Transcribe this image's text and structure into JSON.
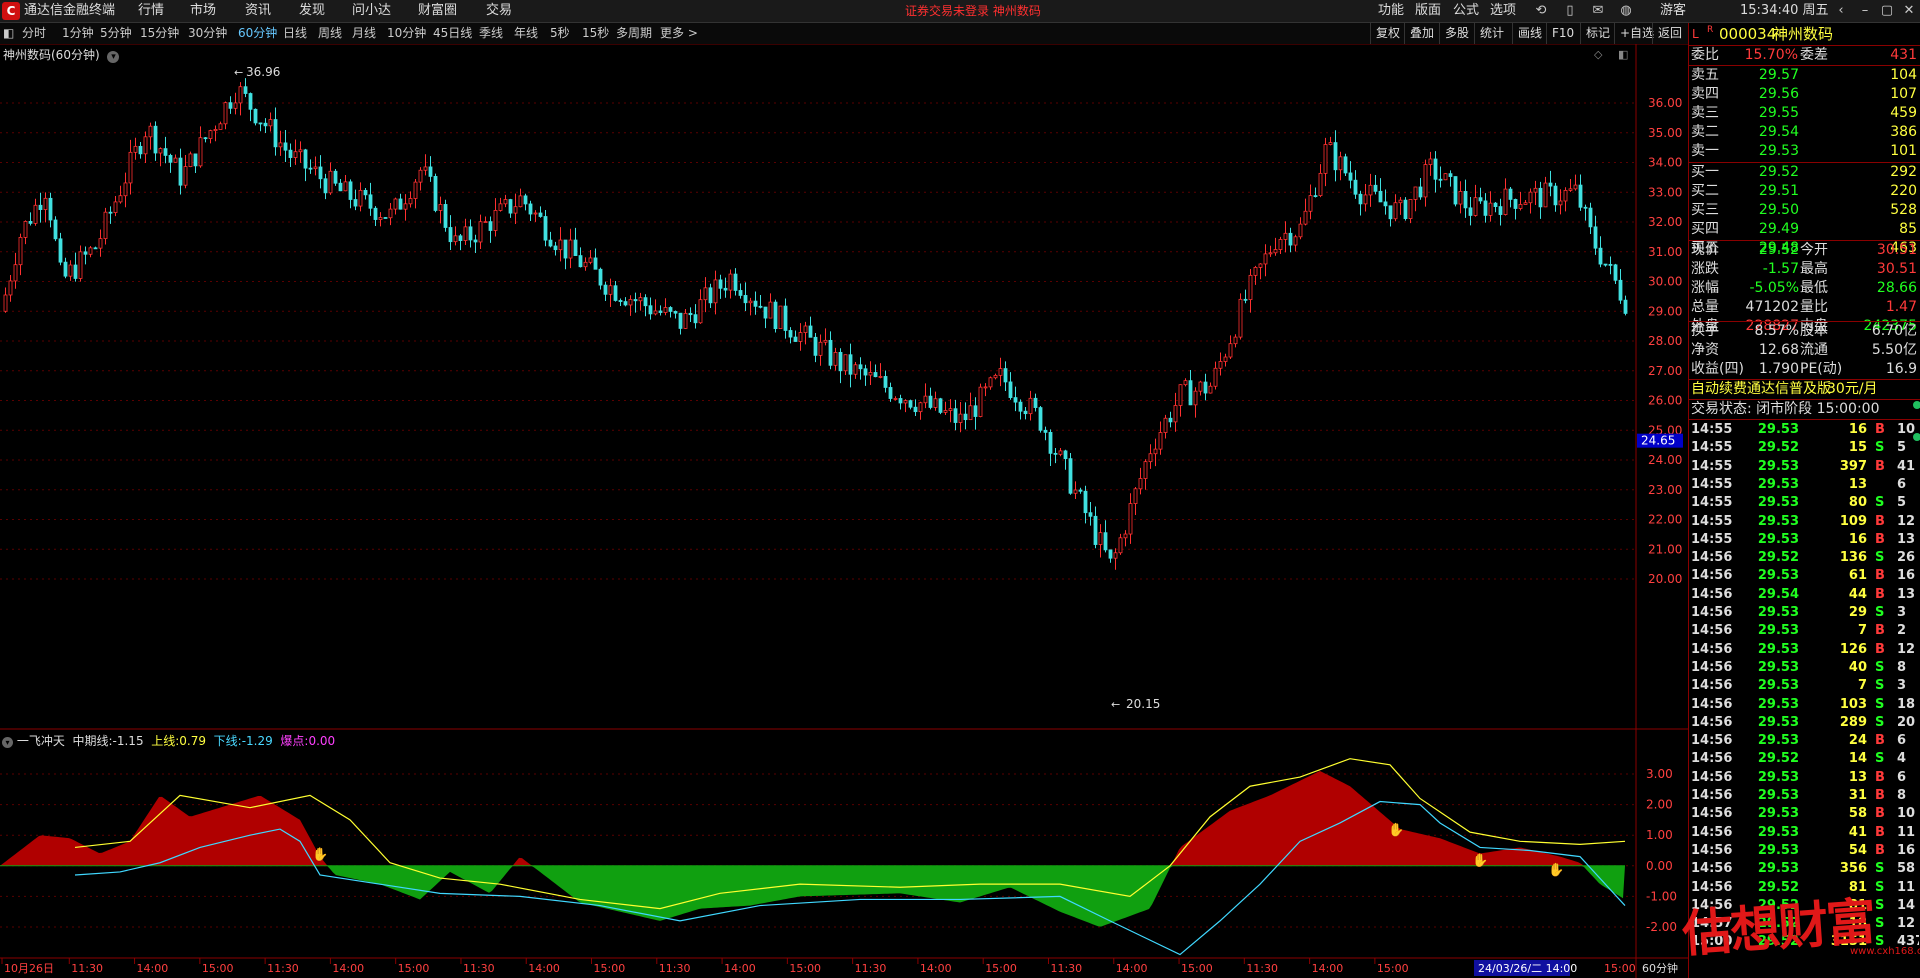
{
  "app": {
    "title": "通达信金融终端",
    "alert": "证券交易未登录  神州数码"
  },
  "menu": [
    "行情",
    "市场",
    "资讯",
    "发现",
    "问小达",
    "财富圈",
    "交易"
  ],
  "right_menu": [
    "功能",
    "版面",
    "公式",
    "选项"
  ],
  "guest": "游客",
  "clock": "15:34:40 周五",
  "periods": [
    "分时",
    "1分钟",
    "5分钟",
    "15分钟",
    "30分钟",
    "60分钟",
    "日线",
    "周线",
    "月线",
    "10分钟",
    "45日线",
    "季线",
    "年线",
    "5秒",
    "15秒",
    "多周期",
    "更多 >"
  ],
  "active_period": "60分钟",
  "tools": [
    "复权",
    "叠加",
    "多股",
    "统计",
    "画线",
    "F10",
    "标记",
    "+自选",
    "返回"
  ],
  "chart": {
    "title": "神州数码(60分钟)",
    "high_label": "36.96",
    "low_label": "20.15",
    "price_ticks": [
      "36.00",
      "35.00",
      "34.00",
      "33.00",
      "32.00",
      "31.00",
      "30.00",
      "29.00",
      "28.00",
      "27.00",
      "26.00",
      "25.00",
      "24.00",
      "23.00",
      "22.00",
      "21.00",
      "20.00"
    ],
    "price_marker": "24.65",
    "ind_ticks": [
      "3.00",
      "2.00",
      "1.00",
      "0.00",
      "-1.00",
      "-2.00"
    ],
    "indicator": {
      "name": "一飞冲天",
      "mid_label": "中期线:",
      "mid_value": "-1.15",
      "up_label": "上线:",
      "up_value": "0.79",
      "down_label": "下线:",
      "down_value": "-1.29",
      "burst_label": "爆点:",
      "burst_value": "0.00"
    },
    "time_axis": [
      "10月26日",
      "11:30",
      "14:00",
      "15:00",
      "11:30",
      "14:00",
      "15:00",
      "11:30",
      "14:00",
      "15:00",
      "11:30",
      "14:00",
      "15:00",
      "11:30",
      "14:00",
      "15:00",
      "11:30",
      "14:00",
      "15:00",
      "11:30",
      "14:00",
      "15:00"
    ],
    "cursor_time": "24/03/26/二 14:00",
    "last_time": "15:00",
    "period_label": "60分钟"
  },
  "quote": {
    "code": "000034",
    "name": "神州数码",
    "wb_label": "委比",
    "wb": "15.70%",
    "wc_label": "委差",
    "wc": "431",
    "asks": [
      {
        "label": "卖五",
        "price": "29.57",
        "vol": "104"
      },
      {
        "label": "卖四",
        "price": "29.56",
        "vol": "107"
      },
      {
        "label": "卖三",
        "price": "29.55",
        "vol": "459"
      },
      {
        "label": "卖二",
        "price": "29.54",
        "vol": "386"
      },
      {
        "label": "卖一",
        "price": "29.53",
        "vol": "101"
      }
    ],
    "bids": [
      {
        "label": "买一",
        "price": "29.52",
        "vol": "292"
      },
      {
        "label": "买二",
        "price": "29.51",
        "vol": "220"
      },
      {
        "label": "买三",
        "price": "29.50",
        "vol": "528"
      },
      {
        "label": "买四",
        "price": "29.49",
        "vol": "85"
      },
      {
        "label": "买五",
        "price": "29.48",
        "vol": "463"
      }
    ],
    "stats": [
      {
        "l1": "现价",
        "v1": "29.52",
        "c1": "green",
        "l2": "今开",
        "v2": "30.51",
        "c2": "red"
      },
      {
        "l1": "涨跌",
        "v1": "-1.57",
        "c1": "green",
        "l2": "最高",
        "v2": "30.51",
        "c2": "red"
      },
      {
        "l1": "涨幅",
        "v1": "-5.05%",
        "c1": "green",
        "l2": "最低",
        "v2": "28.66",
        "c2": "green"
      },
      {
        "l1": "总量",
        "v1": "471202",
        "c1": "white",
        "l2": "量比",
        "v2": "1.47",
        "c2": "red"
      },
      {
        "l1": "外盘",
        "v1": "228827",
        "c1": "red",
        "l2": "内盘",
        "v2": "242375",
        "c2": "green"
      }
    ],
    "fin": [
      {
        "l1": "换手",
        "v1": "8.57%",
        "l2": "股本",
        "v2": "6.70亿"
      },
      {
        "l1": "净资",
        "v1": "12.68",
        "l2": "流通",
        "v2": "5.50亿"
      },
      {
        "l1": "收益(四)",
        "v1": "1.790",
        "l2": "PE(动)",
        "v2": "16.9"
      }
    ],
    "promo": "自动续费通达信普及版",
    "promo_price": "30元/月",
    "status": "交易状态: 闭市阶段 15:00:00"
  },
  "ticks": [
    {
      "t": "14:55",
      "p": "29.53",
      "v": "16",
      "d": "B",
      "n": "10"
    },
    {
      "t": "14:55",
      "p": "29.52",
      "v": "15",
      "d": "S",
      "n": "5"
    },
    {
      "t": "14:55",
      "p": "29.53",
      "v": "397",
      "d": "B",
      "n": "41"
    },
    {
      "t": "14:55",
      "p": "29.53",
      "v": "13",
      "d": "",
      "n": "6"
    },
    {
      "t": "14:55",
      "p": "29.53",
      "v": "80",
      "d": "S",
      "n": "5"
    },
    {
      "t": "14:55",
      "p": "29.53",
      "v": "109",
      "d": "B",
      "n": "12"
    },
    {
      "t": "14:55",
      "p": "29.53",
      "v": "16",
      "d": "B",
      "n": "13"
    },
    {
      "t": "14:56",
      "p": "29.52",
      "v": "136",
      "d": "S",
      "n": "26"
    },
    {
      "t": "14:56",
      "p": "29.53",
      "v": "61",
      "d": "B",
      "n": "16"
    },
    {
      "t": "14:56",
      "p": "29.54",
      "v": "44",
      "d": "B",
      "n": "13"
    },
    {
      "t": "14:56",
      "p": "29.53",
      "v": "29",
      "d": "S",
      "n": "3"
    },
    {
      "t": "14:56",
      "p": "29.53",
      "v": "7",
      "d": "B",
      "n": "2"
    },
    {
      "t": "14:56",
      "p": "29.53",
      "v": "126",
      "d": "B",
      "n": "12"
    },
    {
      "t": "14:56",
      "p": "29.53",
      "v": "40",
      "d": "S",
      "n": "8"
    },
    {
      "t": "14:56",
      "p": "29.53",
      "v": "7",
      "d": "S",
      "n": "3"
    },
    {
      "t": "14:56",
      "p": "29.53",
      "v": "103",
      "d": "S",
      "n": "18"
    },
    {
      "t": "14:56",
      "p": "29.53",
      "v": "289",
      "d": "S",
      "n": "20"
    },
    {
      "t": "14:56",
      "p": "29.53",
      "v": "24",
      "d": "B",
      "n": "6"
    },
    {
      "t": "14:56",
      "p": "29.52",
      "v": "14",
      "d": "S",
      "n": "4"
    },
    {
      "t": "14:56",
      "p": "29.53",
      "v": "13",
      "d": "B",
      "n": "6"
    },
    {
      "t": "14:56",
      "p": "29.53",
      "v": "31",
      "d": "B",
      "n": "8"
    },
    {
      "t": "14:56",
      "p": "29.53",
      "v": "58",
      "d": "B",
      "n": "10"
    },
    {
      "t": "14:56",
      "p": "29.53",
      "v": "41",
      "d": "B",
      "n": "11"
    },
    {
      "t": "14:56",
      "p": "29.53",
      "v": "54",
      "d": "B",
      "n": "16"
    },
    {
      "t": "14:56",
      "p": "29.53",
      "v": "356",
      "d": "S",
      "n": "58"
    },
    {
      "t": "14:56",
      "p": "29.52",
      "v": "81",
      "d": "S",
      "n": "11"
    },
    {
      "t": "14:56",
      "p": "29.52",
      "v": "81",
      "d": "S",
      "n": "14"
    },
    {
      "t": "14:57",
      "p": "29.52",
      "v": "18",
      "d": "S",
      "n": "12"
    },
    {
      "t": "15:00",
      "p": "29.52",
      "v": "3151",
      "d": "S",
      "n": "437"
    }
  ],
  "watermark": "估想财富",
  "watermark_site": "www.cxh168.cn"
}
